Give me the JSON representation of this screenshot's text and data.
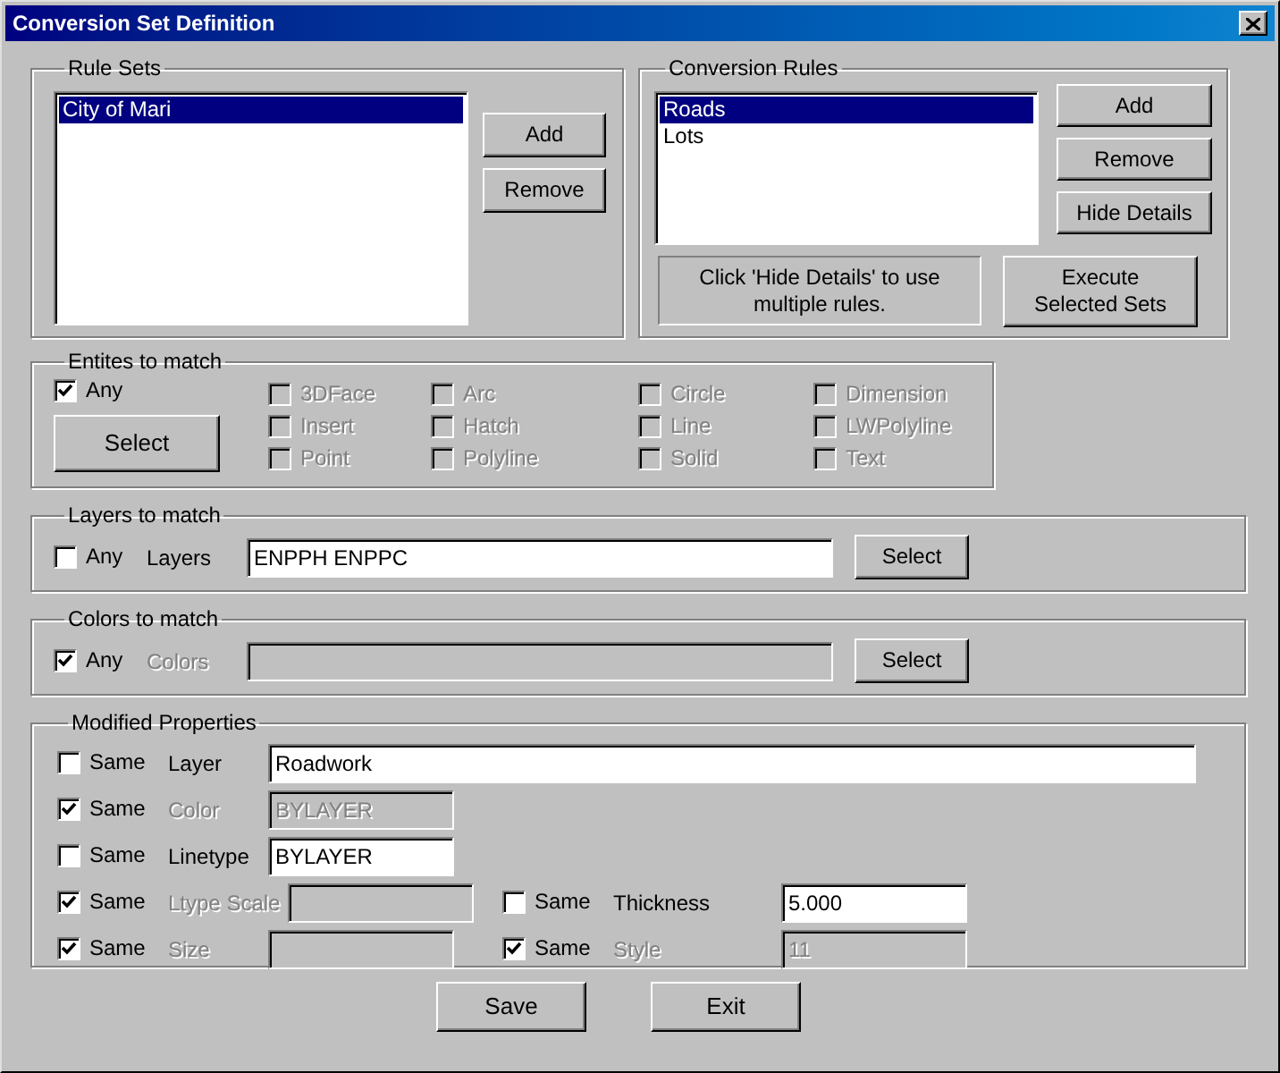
{
  "window": {
    "title": "Conversion Set Definition"
  },
  "rule_sets": {
    "title": "Rule Sets",
    "items": [
      {
        "label": "City of Mari",
        "selected": true
      }
    ],
    "buttons": [
      "Add",
      "Remove"
    ]
  },
  "conversion_rules": {
    "title": "Conversion Rules",
    "items": [
      {
        "label": "Roads",
        "selected": true
      },
      {
        "label": "Lots",
        "selected": false
      }
    ],
    "buttons": [
      "Add",
      "Remove",
      "Hide Details"
    ],
    "note": "Click 'Hide Details' to use multiple rules.",
    "execute_button": "Execute Selected Sets"
  },
  "entities": {
    "title": "Entites to match",
    "any": {
      "label": "Any",
      "checked": true
    },
    "select_button": "Select",
    "options": [
      {
        "label": "3DFace",
        "checked": false,
        "disabled": true
      },
      {
        "label": "Arc",
        "checked": false,
        "disabled": true
      },
      {
        "label": "Circle",
        "checked": false,
        "disabled": true
      },
      {
        "label": "Dimension",
        "checked": false,
        "disabled": true
      },
      {
        "label": "Insert",
        "checked": false,
        "disabled": true
      },
      {
        "label": "Hatch",
        "checked": false,
        "disabled": true
      },
      {
        "label": "Line",
        "checked": false,
        "disabled": true
      },
      {
        "label": "LWPolyline",
        "checked": false,
        "disabled": true
      },
      {
        "label": "Point",
        "checked": false,
        "disabled": true
      },
      {
        "label": "Polyline",
        "checked": false,
        "disabled": true
      },
      {
        "label": "Solid",
        "checked": false,
        "disabled": true
      },
      {
        "label": "Text",
        "checked": false,
        "disabled": true
      }
    ]
  },
  "layers": {
    "title": "Layers to match",
    "any": {
      "label": "Any",
      "checked": false
    },
    "label": "Layers",
    "disabled": false,
    "value": "ENPPH ENPPC",
    "select_button": "Select"
  },
  "colors": {
    "title": "Colors to match",
    "any": {
      "label": "Any",
      "checked": true
    },
    "label": "Colors",
    "disabled": true,
    "select_button": "Select"
  },
  "modified_properties": {
    "title": "Modified Properties",
    "rows": [
      {
        "fields": [
          {
            "same": {
              "label": "Same",
              "checked": false
            },
            "label": "Layer",
            "disabled": false,
            "value": "Roadwork",
            "kind": "wide"
          }
        ]
      },
      {
        "fields": [
          {
            "same": {
              "label": "Same",
              "checked": true
            },
            "label": "Color",
            "disabled": true,
            "value": "BYLAYER",
            "kind": "short"
          }
        ]
      },
      {
        "fields": [
          {
            "same": {
              "label": "Same",
              "checked": false
            },
            "label": "Linetype",
            "disabled": false,
            "value": "BYLAYER",
            "kind": "short"
          }
        ]
      },
      {
        "fields": [
          {
            "same": {
              "label": "Same",
              "checked": true
            },
            "label": "Ltype Scale",
            "disabled": true,
            "kind": "short"
          },
          {
            "same": {
              "label": "Same",
              "checked": false
            },
            "label": "Thickness",
            "disabled": false,
            "value": "5.000",
            "kind": "short"
          }
        ]
      },
      {
        "fields": [
          {
            "same": {
              "label": "Same",
              "checked": true
            },
            "label": "Size",
            "disabled": true,
            "kind": "short"
          },
          {
            "same": {
              "label": "Same",
              "checked": true
            },
            "label": "Style",
            "disabled": true,
            "value": "11",
            "kind": "short"
          }
        ]
      }
    ]
  },
  "buttons": [
    "Save",
    "Exit"
  ]
}
